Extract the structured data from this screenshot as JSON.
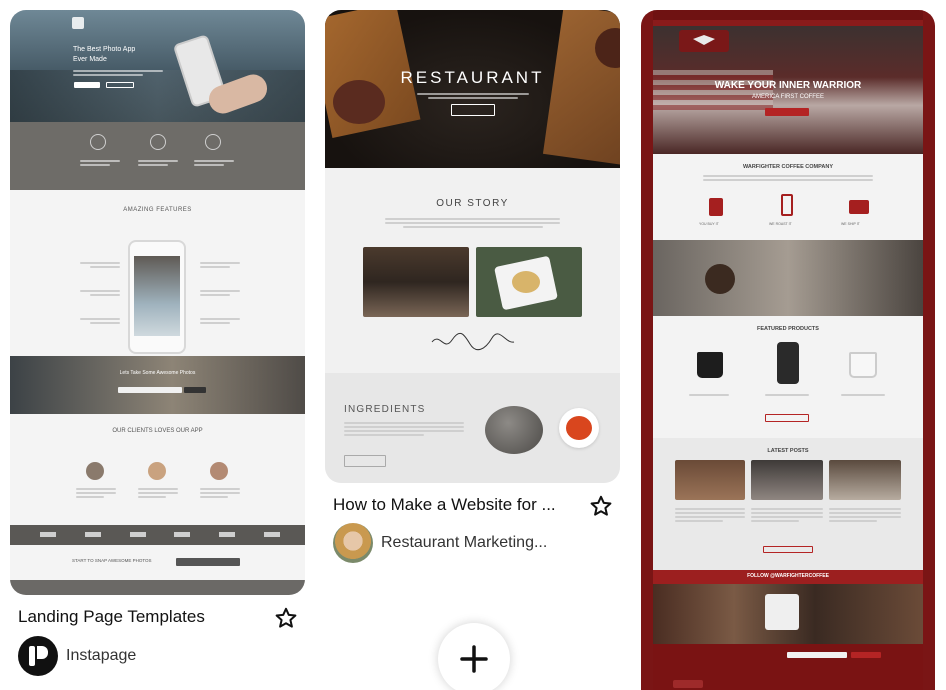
{
  "pins": [
    {
      "title": "Landing Page Templates",
      "author": "Instapage",
      "preview": {
        "hero_title_1": "The Best Photo App",
        "hero_title_2": "Ever Made",
        "features_title": "AMAZING FEATURES",
        "band_title": "Lets Take Some Awesome Photos",
        "clients_title": "OUR CLIENTS LOVES OUR APP",
        "cta_text": "START TO SNAP AWESOME PHOTOS"
      }
    },
    {
      "title": "How to Make a Website for ...",
      "author": "Restaurant Marketing...",
      "preview": {
        "hero_title": "RESTAURANT",
        "story_title": "OUR STORY",
        "ingredients_title": "INGREDIENTS"
      }
    },
    {
      "title": "",
      "author": "",
      "preview": {
        "hero_title": "WAKE YOUR INNER WARRIOR",
        "hero_sub": "AMERICA FIRST COFFEE",
        "company_title": "WARFIGHTER COFFEE COMPANY",
        "you_buy": "YOU BUY IT",
        "we_roast": "WE ROAST IT",
        "we_ship": "WE SHIP IT",
        "products_title": "FEATURED PRODUCTS",
        "posts_title": "LATEST POSTS",
        "follow": "FOLLOW @WARFIGHTERCOFFEE"
      }
    }
  ],
  "icons": {
    "star": "star-outline-icon",
    "plus": "plus-icon"
  },
  "colors": {
    "warfighter_red": "#7a1515",
    "instapage_avatar": "#111111"
  }
}
